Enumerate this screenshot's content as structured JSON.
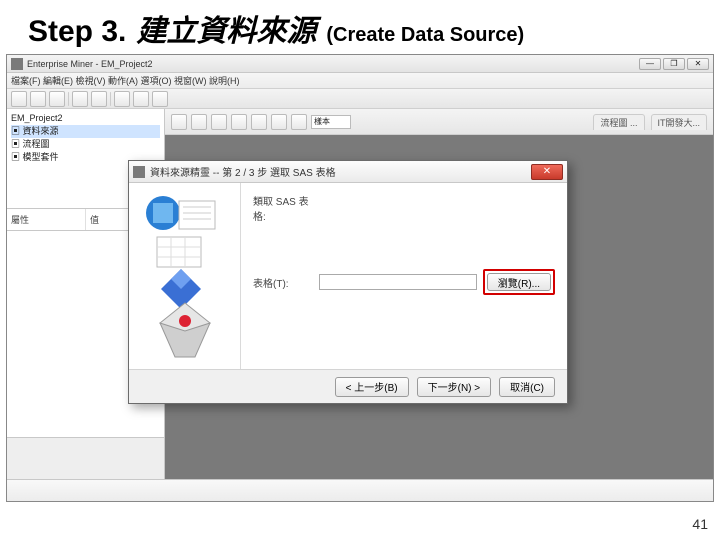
{
  "slide": {
    "step": "Step 3.",
    "title_cjk": "建立資料來源",
    "title_en": "(Create Data Source)",
    "page_number": "41"
  },
  "app": {
    "title": "Enterprise Miner - EM_Project2",
    "menu": "檔案(F)  編輯(E)  檢視(V)  動作(A)  選項(O)  視窗(W)  說明(H)",
    "tree": {
      "root": "EM_Project2",
      "n1": "▣ 資料來源",
      "n2": "▣ 流程圖",
      "n3": "▣ 模型套件"
    },
    "props": {
      "col1": "屬性",
      "col2": "值"
    },
    "canvas": {
      "selector": "樣本",
      "tab1": "流程圖 ...",
      "tab2": "IT開發大..."
    }
  },
  "wizard": {
    "title": "資料來源精靈 -- 第 2 / 3 步 選取 SAS 表格",
    "field1_label": "類取 SAS 表格:",
    "field1_value": "",
    "field2_label": "表格(T):",
    "field2_value": "",
    "browse": "瀏覽(R)...",
    "back": "< 上一步(B)",
    "next": "下一步(N) >",
    "cancel": "取消(C)"
  }
}
